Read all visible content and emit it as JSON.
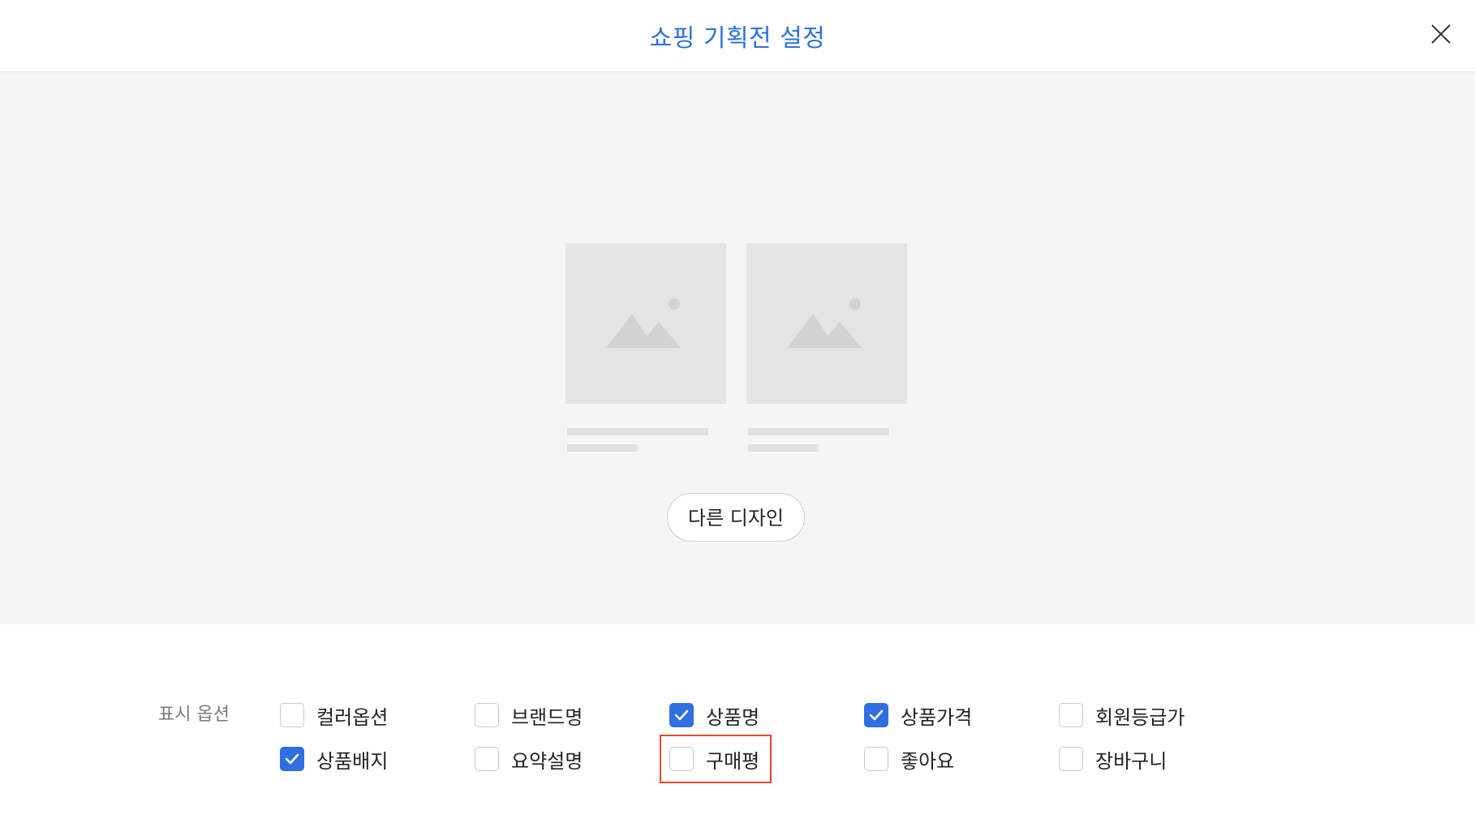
{
  "header": {
    "title": "쇼핑 기획전 설정",
    "close_icon": "close-icon"
  },
  "preview": {
    "cards": [
      {
        "icon": "image-placeholder-icon"
      },
      {
        "icon": "image-placeholder-icon"
      }
    ],
    "design_button_label": "다른 디자인"
  },
  "options": {
    "label": "표시 옵션",
    "accent_color": "#2f6fe0",
    "highlight_color": "#e04a2a",
    "items": [
      {
        "label": "컬러옵션",
        "checked": false
      },
      {
        "label": "브랜드명",
        "checked": false
      },
      {
        "label": "상품명",
        "checked": true
      },
      {
        "label": "상품가격",
        "checked": true
      },
      {
        "label": "회원등급가",
        "checked": false
      },
      {
        "label": "상품배지",
        "checked": true
      },
      {
        "label": "요약설명",
        "checked": false
      },
      {
        "label": "구매평",
        "checked": false
      },
      {
        "label": "좋아요",
        "checked": false
      },
      {
        "label": "장바구니",
        "checked": false
      }
    ]
  }
}
